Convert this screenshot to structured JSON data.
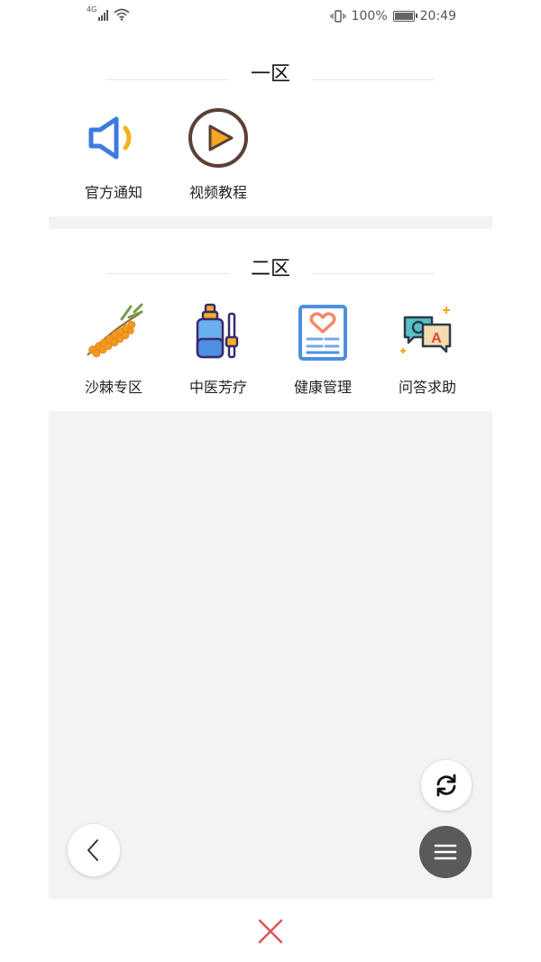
{
  "status_bar": {
    "network": "4G",
    "battery_percent": "100%",
    "time": "20:49"
  },
  "section1": {
    "title": "一区",
    "items": [
      {
        "label": "官方通知",
        "icon": "speaker-icon"
      },
      {
        "label": "视频教程",
        "icon": "play-icon"
      }
    ]
  },
  "section2": {
    "title": "二区",
    "items": [
      {
        "label": "沙棘专区",
        "icon": "sea-buckthorn-icon"
      },
      {
        "label": "中医芳疗",
        "icon": "aromatherapy-icon"
      },
      {
        "label": "健康管理",
        "icon": "health-record-icon"
      },
      {
        "label": "问答求助",
        "icon": "qa-chat-icon"
      }
    ]
  },
  "colors": {
    "content_background": "#f3f3f3",
    "fab_dark": "#5a5a5a",
    "close_red": "#e05555",
    "speaker_blue": "#3d7be0",
    "play_orange": "#f5a623"
  },
  "floating_buttons": {
    "refresh": "refresh-icon",
    "back": "back-chevron-icon",
    "menu": "menu-icon"
  },
  "bottom": {
    "close": "close-icon"
  }
}
